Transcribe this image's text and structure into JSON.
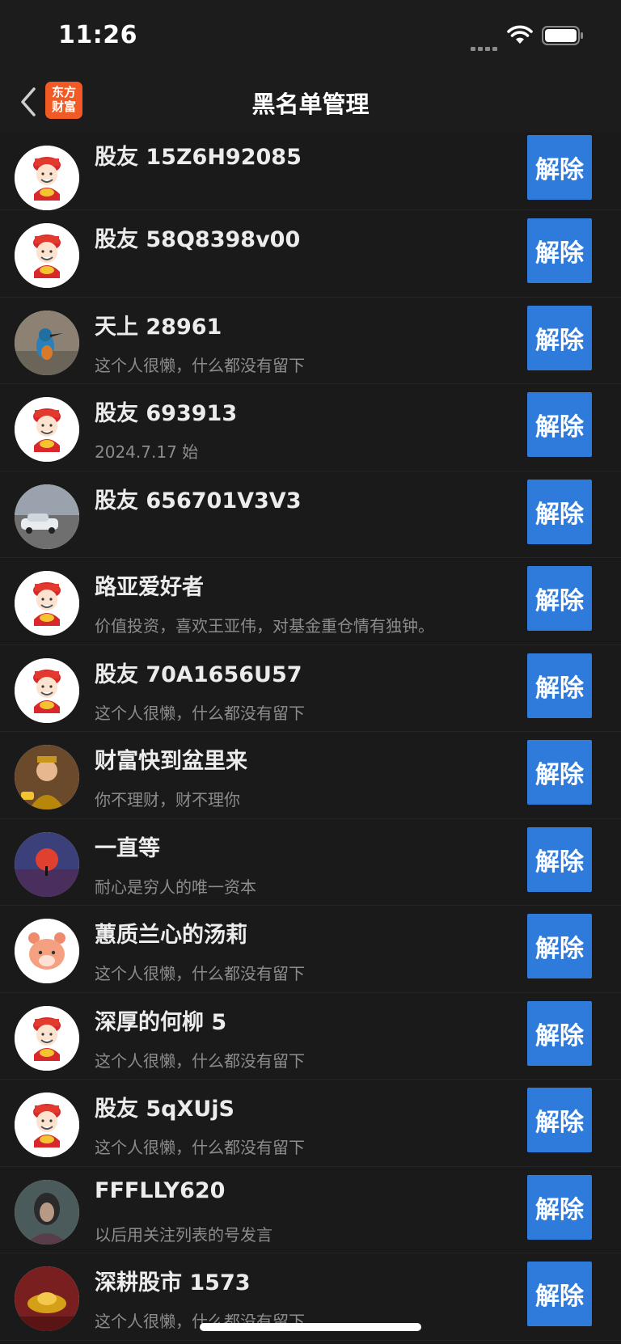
{
  "status_bar": {
    "time": "11:26"
  },
  "nav": {
    "title": "黑名单管理",
    "logo_line1": "东方",
    "logo_line2": "财富"
  },
  "list": {
    "button_label": "解除",
    "rows": [
      {
        "name": "股友 15Z6H92085",
        "sub": "",
        "avatar": "caishen-icon"
      },
      {
        "name": "股友 58Q8398v00",
        "sub": "",
        "avatar": "caishen-icon"
      },
      {
        "name": "天上 28961",
        "sub": "这个人很懒，什么都没有留下",
        "avatar": "kingfisher-photo"
      },
      {
        "name": "股友 693913",
        "sub": "2024.7.17 始",
        "avatar": "caishen-icon"
      },
      {
        "name": "股友 656701V3V3",
        "sub": "",
        "avatar": "car-photo"
      },
      {
        "name": "路亚爱好者",
        "sub": "价值投资，喜欢王亚伟，对基金重仓情有独钟。",
        "avatar": "caishen-icon"
      },
      {
        "name": "股友 70A1656U57",
        "sub": "这个人很懒，什么都没有留下",
        "avatar": "caishen-icon"
      },
      {
        "name": "财富快到盆里来",
        "sub": "你不理财，财不理你",
        "avatar": "god-of-wealth-photo"
      },
      {
        "name": "一直等",
        "sub": "耐心是穷人的唯一资本",
        "avatar": "red-sun-photo"
      },
      {
        "name": "蕙质兰心的汤莉",
        "sub": "这个人很懒，什么都没有留下",
        "avatar": "tiger-icon"
      },
      {
        "name": "深厚的何柳 5",
        "sub": "这个人很懒，什么都没有留下",
        "avatar": "caishen-icon"
      },
      {
        "name": "股友 5qXUjS",
        "sub": "这个人很懒，什么都没有留下",
        "avatar": "caishen-icon"
      },
      {
        "name": "FFFLLY620",
        "sub": "以后用关注列表的号发言",
        "avatar": "portrait-photo"
      },
      {
        "name": "深耕股市 1573",
        "sub": "这个人很懒，什么都没有留下",
        "avatar": "gold-ingot-photo"
      }
    ]
  }
}
